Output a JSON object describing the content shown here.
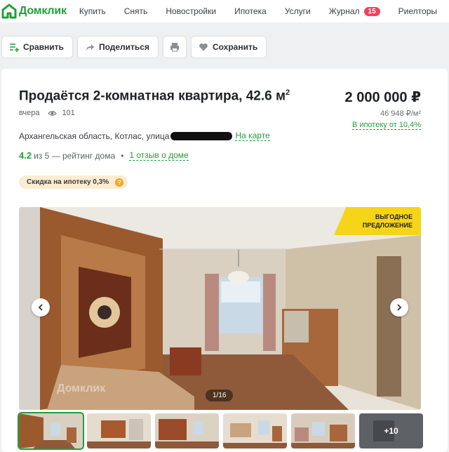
{
  "brand": {
    "name": "Домклик",
    "color": "#21a038",
    "icon": "domclick-logo-icon"
  },
  "nav": {
    "items": [
      {
        "label": "Купить"
      },
      {
        "label": "Снять"
      },
      {
        "label": "Новостройки"
      },
      {
        "label": "Ипотека"
      },
      {
        "label": "Услуги"
      },
      {
        "label": "Журнал",
        "badge": "15"
      },
      {
        "label": "Риелторы"
      }
    ]
  },
  "actions": {
    "compare": "Сравнить",
    "share": "Поделиться",
    "print_icon": "printer-icon",
    "save": "Сохранить"
  },
  "listing": {
    "title": "Продаётся 2-комнатная квартира, 42.6 м",
    "title_sup": "2",
    "published": "вчера",
    "views": "101",
    "address": "Архангельская область, Котлас, улица",
    "map_link": "На карте",
    "rating_value": "4.2",
    "rating_rest": "из 5 — рейтинг дома",
    "reviews_link": "1 отзыв о доме",
    "discount_badge": "Скидка на ипотеку 0,3%",
    "discount_help": "?",
    "price": "2 000 000 ₽",
    "price_per_m2": "46 948 ₽/м²",
    "mortgage_link": "В ипотеку от 10,4%"
  },
  "gallery": {
    "promo_line1": "ВЫГОДНОЕ",
    "promo_line2": "ПРЕДЛОЖЕНИЕ",
    "counter": "1/16",
    "watermark": "Домклик",
    "more_label": "+10"
  },
  "colors": {
    "accent": "#21a038",
    "badge": "#f0445c",
    "promo": "#f6d417",
    "discount_bg": "#fcecd0"
  }
}
